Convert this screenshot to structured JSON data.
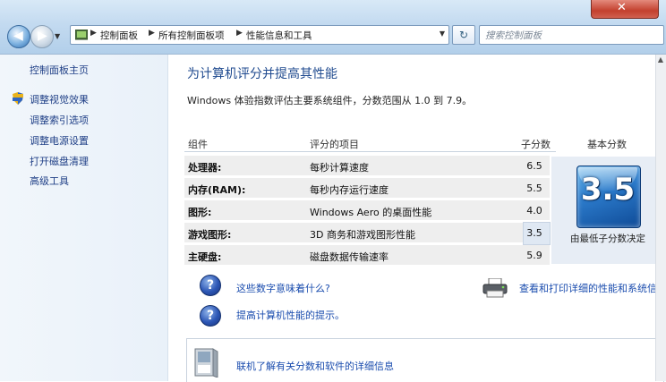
{
  "breadcrumb": [
    "控制面板",
    "所有控制面板项",
    "性能信息和工具"
  ],
  "search": {
    "placeholder": "搜索控制面板"
  },
  "sidebar": {
    "items": [
      {
        "label": "控制面板主页"
      },
      {
        "label": "调整视觉效果"
      },
      {
        "label": "调整索引选项"
      },
      {
        "label": "调整电源设置"
      },
      {
        "label": "打开磁盘清理"
      },
      {
        "label": "高级工具"
      }
    ]
  },
  "main": {
    "title": "为计算机评分并提高其性能",
    "subtitle": "Windows 体验指数评估主要系统组件，分数范围从 1.0 到 7.9。",
    "table": {
      "headers": [
        "组件",
        "评分的项目",
        "子分数",
        "基本分数"
      ],
      "rows": [
        {
          "component": "处理器:",
          "item": "每秒计算速度",
          "subscore": "6.5"
        },
        {
          "component": "内存(RAM):",
          "item": "每秒内存运行速度",
          "subscore": "5.5"
        },
        {
          "component": "图形:",
          "item": "Windows Aero 的桌面性能",
          "subscore": "4.0"
        },
        {
          "component": "游戏图形:",
          "item": "3D 商务和游戏图形性能",
          "subscore": "3.5"
        },
        {
          "component": "主硬盘:",
          "item": "磁盘数据传输速率",
          "subscore": "5.9"
        }
      ],
      "base_score": "3.5",
      "base_note": "由最低子分数决定"
    },
    "links": {
      "meaning": "这些数字意味着什么?",
      "tips": "提高计算机性能的提示。",
      "print": "查看和打印详细的性能和系统信息",
      "online": "联机了解有关分数和软件的详细信息"
    }
  },
  "colors": {
    "link": "#1a4cae",
    "title": "#1f4a8f",
    "tile": "#2a78c8"
  }
}
